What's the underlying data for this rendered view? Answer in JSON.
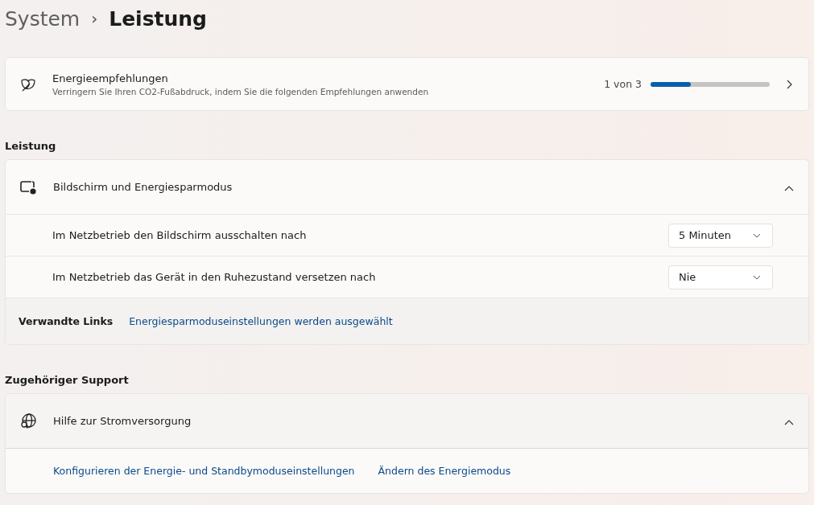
{
  "breadcrumb": {
    "parent": "System",
    "separator": "›",
    "current": "Leistung"
  },
  "recommendations": {
    "title": "Energieempfehlungen",
    "subtitle": "Verringern Sie Ihren CO2-Fußabdruck, indem Sie die folgenden Empfehlungen anwenden",
    "progress_text": "1 von 3",
    "level": 0.34
  },
  "performance_section": {
    "heading": "Leistung",
    "card": {
      "title": "Bildschirm und Energiesparmodus",
      "expanded": true,
      "settings": [
        {
          "label": "Im Netzbetrieb den Bildschirm ausschalten nach",
          "value": "5 Minuten"
        },
        {
          "label": "Im Netzbetrieb das Gerät in den Ruhezustand versetzen nach",
          "value": "Nie"
        }
      ],
      "related_label": "Verwandte Links",
      "related_links": [
        "Energiesparmoduseinstellungen werden ausgewählt"
      ]
    }
  },
  "support_section": {
    "heading": "Zugehöriger Support",
    "card": {
      "title": "Hilfe zur Stromversorgung",
      "expanded": true,
      "links": [
        "Konfigurieren der Energie- und Standbymoduseinstellungen",
        "Ändern des Energiemodus"
      ]
    }
  }
}
